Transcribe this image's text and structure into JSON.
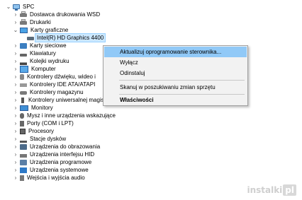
{
  "tree": {
    "root": "SPC",
    "items": [
      {
        "label": "Dostawca drukowania WSD",
        "icon": "printer-icon",
        "expanded": false
      },
      {
        "label": "Drukarki",
        "icon": "printer-icon",
        "expanded": false
      },
      {
        "label": "Karty graficzne",
        "icon": "monitor-icon",
        "expanded": true
      },
      {
        "label": "Intel(R) HD Graphics 4400",
        "icon": "graphics-card-icon",
        "child": true,
        "selected": true
      },
      {
        "label": "Karty sieciowe",
        "icon": "network-adapter-icon",
        "expanded": false
      },
      {
        "label": "Klawiatury",
        "icon": "keyboard-icon",
        "expanded": false
      },
      {
        "label": "Kolejki wydruku",
        "icon": "print-queue-icon",
        "expanded": false
      },
      {
        "label": "Komputer",
        "icon": "computer-icon",
        "expanded": false
      },
      {
        "label": "Kontrolery dźwięku, wideo i",
        "icon": "sound-icon",
        "expanded": false
      },
      {
        "label": "Kontrolery IDE ATA/ATAPI",
        "icon": "ide-icon",
        "expanded": false
      },
      {
        "label": "Kontrolery magazynu",
        "icon": "storage-icon",
        "expanded": false
      },
      {
        "label": "Kontrolery uniwersalnej magistrali szeregowej",
        "icon": "usb-icon",
        "expanded": false
      },
      {
        "label": "Monitory",
        "icon": "monitor-icon",
        "expanded": false
      },
      {
        "label": "Mysz i inne urządzenia wskazujące",
        "icon": "mouse-icon",
        "expanded": false
      },
      {
        "label": "Porty (COM i LPT)",
        "icon": "port-icon",
        "expanded": false
      },
      {
        "label": "Procesory",
        "icon": "processor-icon",
        "expanded": false
      },
      {
        "label": "Stacje dysków",
        "icon": "disk-drive-icon",
        "expanded": false
      },
      {
        "label": "Urządzenia do obrazowania",
        "icon": "imaging-icon",
        "expanded": false
      },
      {
        "label": "Urządzenia interfejsu HID",
        "icon": "hid-icon",
        "expanded": false
      },
      {
        "label": "Urządzenia programowe",
        "icon": "software-device-icon",
        "expanded": false
      },
      {
        "label": "Urządzenia systemowe",
        "icon": "system-device-icon",
        "expanded": false
      },
      {
        "label": "Wejścia i wyjścia audio",
        "icon": "audio-icon",
        "expanded": false
      }
    ]
  },
  "context_menu": {
    "items": [
      {
        "label": "Aktualizuj oprogramowanie sterownika...",
        "highlighted": true
      },
      {
        "label": "Wyłącz"
      },
      {
        "label": "Odinstaluj"
      },
      {
        "label": "Skanuj w poszukiwaniu zmian sprzętu"
      },
      {
        "label": "Właściwości",
        "bold": true
      }
    ]
  },
  "watermark": {
    "text": "instalki",
    "box": "pl"
  },
  "colors": {
    "selection": "#cce8ff",
    "menu_highlight": "#91c9f7",
    "menu_bg": "#f2f2f2"
  }
}
